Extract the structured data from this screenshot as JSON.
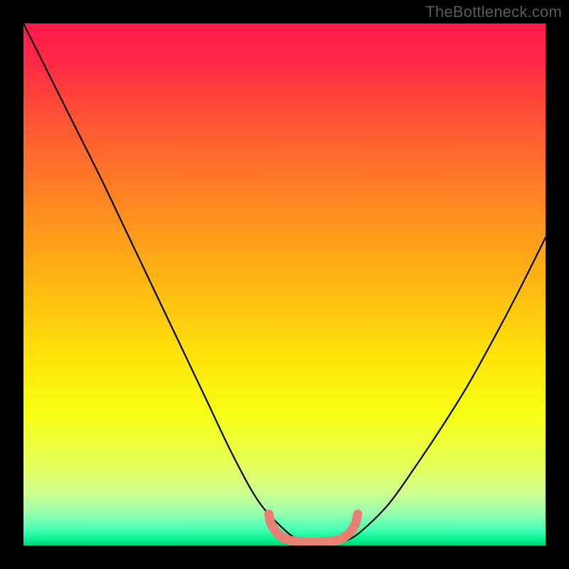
{
  "watermark": "TheBottleneck.com",
  "colors": {
    "frame": "#000000",
    "watermark": "#5a5a5a",
    "optimal_curve": "#e88174",
    "data_curve": "#000000",
    "gradient_stops": [
      {
        "offset": 0.0,
        "color": "#ff1a4d"
      },
      {
        "offset": 0.08,
        "color": "#ff2b45"
      },
      {
        "offset": 0.2,
        "color": "#ff5a33"
      },
      {
        "offset": 0.35,
        "color": "#ff8a22"
      },
      {
        "offset": 0.5,
        "color": "#ffb812"
      },
      {
        "offset": 0.64,
        "color": "#ffe40a"
      },
      {
        "offset": 0.75,
        "color": "#f6ff15"
      },
      {
        "offset": 0.84,
        "color": "#e7ff55"
      },
      {
        "offset": 0.9,
        "color": "#cfff90"
      },
      {
        "offset": 0.94,
        "color": "#93ffb0"
      },
      {
        "offset": 0.97,
        "color": "#45ffb4"
      },
      {
        "offset": 0.985,
        "color": "#12f59a"
      },
      {
        "offset": 1.0,
        "color": "#00d173"
      }
    ]
  },
  "chart_data": {
    "type": "line",
    "title": "",
    "xlabel": "",
    "ylabel": "",
    "xlim": [
      0,
      1
    ],
    "ylim": [
      0,
      1
    ],
    "series": [
      {
        "name": "bottleneck-curve",
        "x": [
          0.0,
          0.05,
          0.1,
          0.15,
          0.2,
          0.25,
          0.3,
          0.35,
          0.4,
          0.45,
          0.5,
          0.53,
          0.56,
          0.59,
          0.62,
          0.65,
          0.7,
          0.75,
          0.8,
          0.85,
          0.9,
          0.95,
          1.0
        ],
        "values": [
          1.0,
          0.9,
          0.8,
          0.7,
          0.595,
          0.49,
          0.385,
          0.28,
          0.175,
          0.085,
          0.03,
          0.01,
          0.005,
          0.005,
          0.01,
          0.03,
          0.08,
          0.15,
          0.225,
          0.305,
          0.395,
          0.49,
          0.59
        ]
      },
      {
        "name": "optimal-zone",
        "x": [
          0.47,
          0.475,
          0.49,
          0.51,
          0.54,
          0.57,
          0.6,
          0.62,
          0.635,
          0.64
        ],
        "values": [
          0.06,
          0.04,
          0.02,
          0.01,
          0.007,
          0.007,
          0.01,
          0.02,
          0.04,
          0.06
        ]
      }
    ],
    "annotations": []
  }
}
